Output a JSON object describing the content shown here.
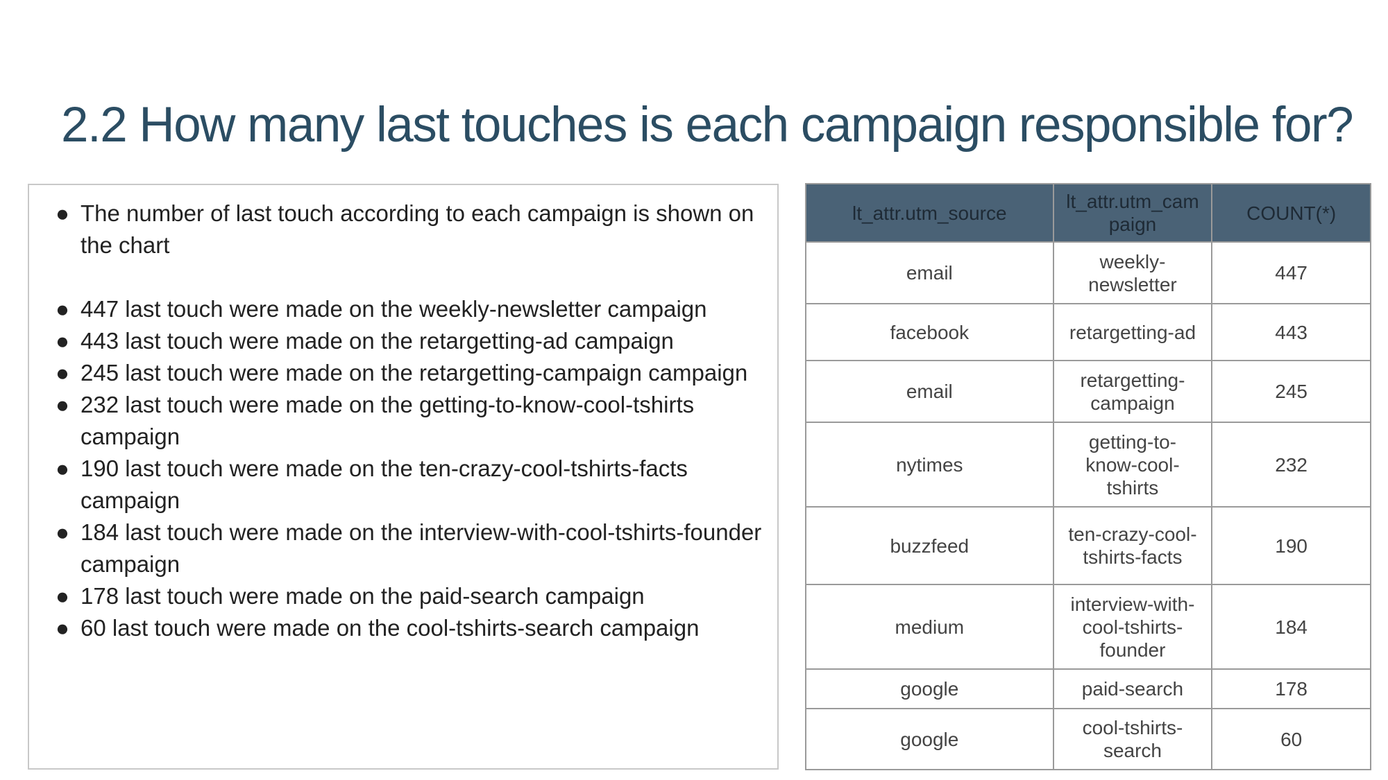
{
  "title": "2.2 How many last touches is each campaign responsible for?",
  "bullets": [
    "The number of last touch according to each campaign is shown on the chart",
    "447 last touch were made on the weekly-newsletter campaign",
    "443 last touch were made on the retargetting-ad campaign",
    "245 last touch were made on the retargetting-campaign campaign",
    "232 last touch were made on the getting-to-know-cool-tshirts campaign",
    "190 last touch were made on the ten-crazy-cool-tshirts-facts campaign",
    "184 last touch were made on the interview-with-cool-tshirts-founder campaign",
    "178 last touch were made on the paid-search campaign",
    "60 last touch were made on the cool-tshirts-search campaign"
  ],
  "bullet_marker": "●",
  "table": {
    "headers": [
      "lt_attr.utm_source",
      "lt_attr.utm_campaign",
      "COUNT(*)"
    ],
    "rows": [
      [
        "email",
        "weekly-newsletter",
        "447"
      ],
      [
        "facebook",
        "retargetting-ad",
        "443"
      ],
      [
        "email",
        "retargetting-campaign",
        "245"
      ],
      [
        "nytimes",
        "getting-to-know-cool-tshirts",
        "232"
      ],
      [
        "buzzfeed",
        "ten-crazy-cool-tshirts-facts",
        "190"
      ],
      [
        "medium",
        "interview-with-cool-tshirts-founder",
        "184"
      ],
      [
        "google",
        "paid-search",
        "178"
      ],
      [
        "google",
        "cool-tshirts-search",
        "60"
      ]
    ]
  },
  "colors": {
    "title": "#2b4d63",
    "table_header_bg": "#4a6276",
    "border": "#9a9a9a"
  }
}
